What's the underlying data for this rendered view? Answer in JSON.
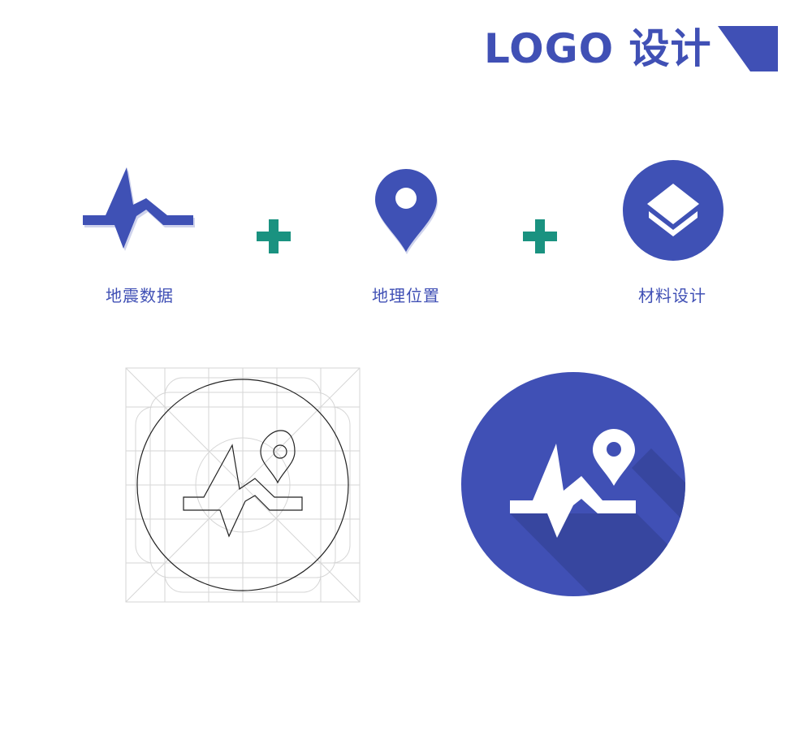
{
  "header": {
    "title": "LOGO 设计"
  },
  "concepts": [
    {
      "label": "地震数据",
      "icon": "seismic-wave-icon"
    },
    {
      "label": "地理位置",
      "icon": "map-pin-icon"
    },
    {
      "label": "材料设计",
      "icon": "layers-icon"
    }
  ],
  "operators": [
    {
      "icon": "plus-icon"
    },
    {
      "icon": "plus-icon"
    }
  ],
  "colors": {
    "brand": "#4050b5",
    "accent": "#1a9280",
    "shadow": "#36449b",
    "grid": "#d6d6d6",
    "outline": "#222222"
  }
}
